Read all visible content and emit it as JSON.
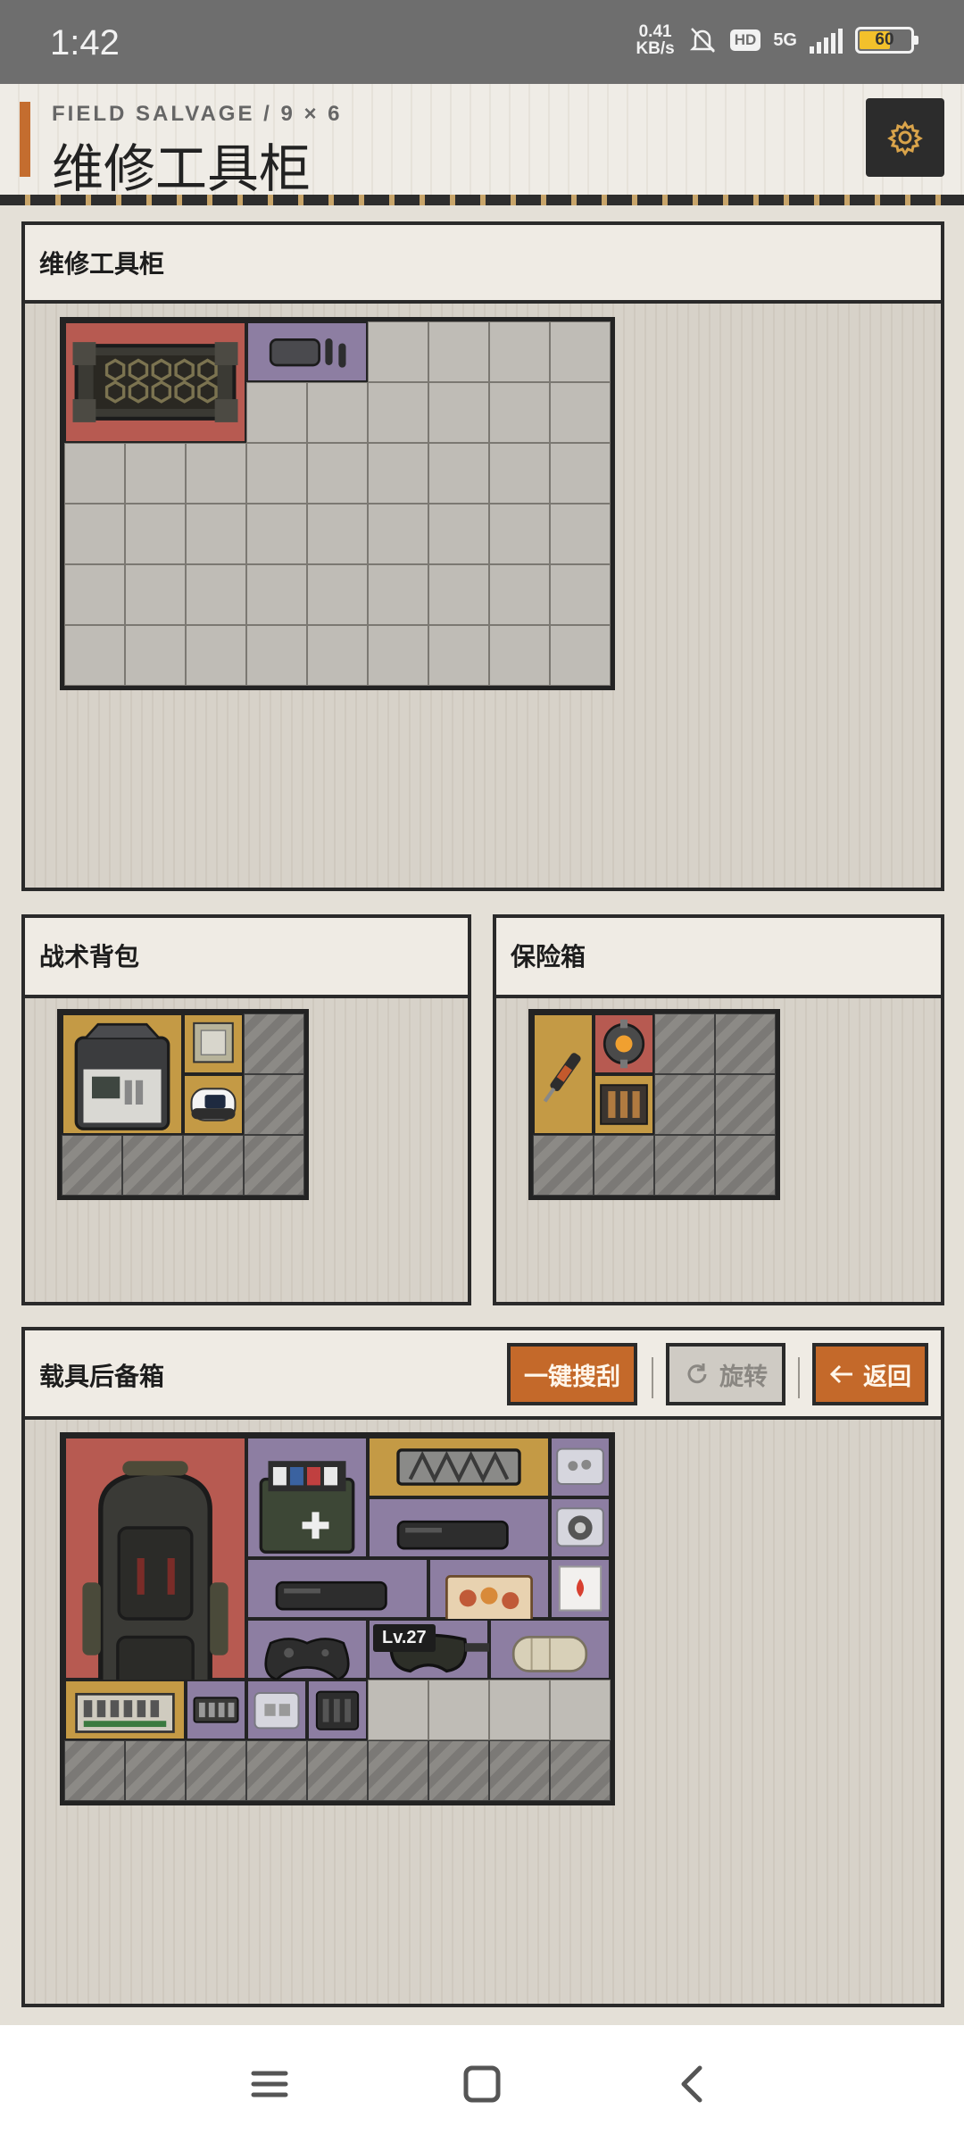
{
  "status_bar": {
    "time": "1:42",
    "net_speed_value": "0.41",
    "net_speed_unit": "KB/s",
    "hd": "HD",
    "network": "5G",
    "battery": "60",
    "icons": [
      "bell-off-icon",
      "signal-icon",
      "battery-icon"
    ]
  },
  "header": {
    "eyebrow": "FIELD SALVAGE / 9 × 6",
    "title": "维修工具柜",
    "settings_icon": "gear-icon",
    "accent_color": "#c46d2f"
  },
  "panels": {
    "main": {
      "title": "维修工具柜",
      "grid_cols": 9,
      "grid_rows": 6
    },
    "backpack": {
      "title": "战术背包",
      "grid_cols": 4,
      "grid_rows": 3
    },
    "safe": {
      "title": "保险箱",
      "grid_cols": 4,
      "grid_rows": 3
    },
    "trunk": {
      "title": "载具后备箱",
      "grid_cols": 9,
      "grid_rows": 6,
      "buttons": {
        "search_all": "一键搜刮",
        "rotate": "旋转",
        "back": "返回"
      },
      "level_badge": "Lv.27"
    }
  },
  "rarity_colors": {
    "red": "#b75a51",
    "purple": "#8d7ea2",
    "gold": "#c49a45"
  },
  "items": {
    "main": [
      "armored-crate-icon",
      "earbuds-case-icon"
    ],
    "backpack": [
      "electronics-case-icon",
      "cpu-chip-icon",
      "pulse-oximeter-icon"
    ],
    "safe": [
      "injector-icon",
      "reactor-core-icon",
      "ammo-box-icon"
    ],
    "trunk": [
      "tactical-backpack-icon",
      "medkit-icon",
      "ammo-crate-icon",
      "screw-case-icon",
      "portable-scanner-icon",
      "bearing-case-icon",
      "portable-scanner-icon",
      "snack-box-icon",
      "fuel-packet-icon",
      "gamepad-icon",
      "goggles-icon",
      "bandage-roll-icon",
      "circuit-board-icon",
      "battery-pack-icon",
      "parts-case-icon",
      "sensor-module-icon"
    ]
  },
  "nav_bar": {
    "icons": [
      "menu-icon",
      "home-icon",
      "back-icon"
    ]
  }
}
